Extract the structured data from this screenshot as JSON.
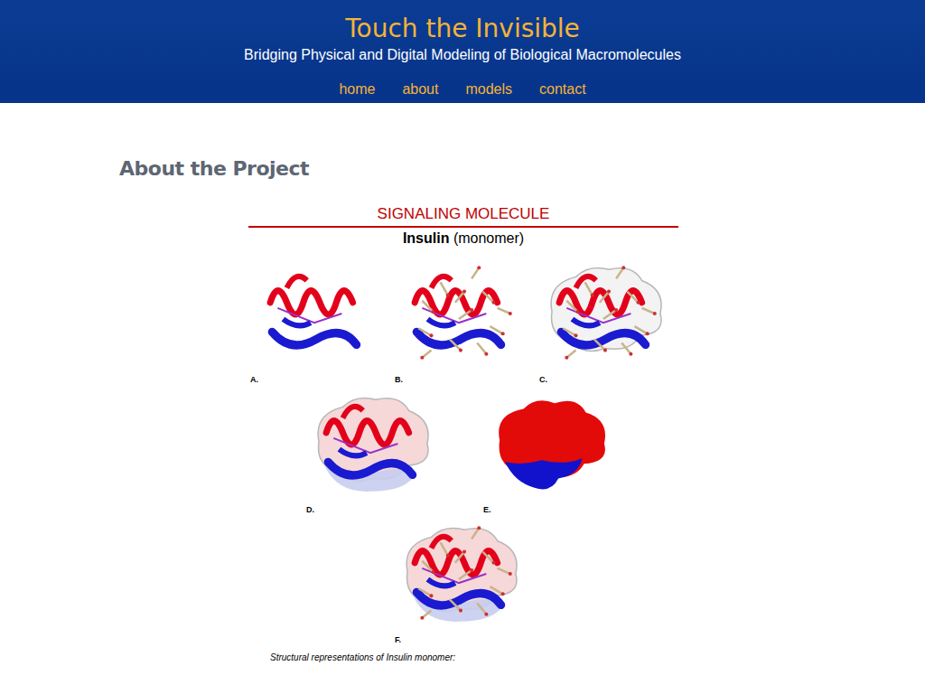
{
  "site": {
    "title": "Touch the Invisible",
    "subtitle": "Bridging Physical and Digital Modeling of Biological Macromolecules"
  },
  "nav": [
    {
      "label": "home"
    },
    {
      "label": "about"
    },
    {
      "label": "models"
    },
    {
      "label": "contact"
    }
  ],
  "page": {
    "heading": "About the Project"
  },
  "figure": {
    "category": "SIGNALING MOLECULE",
    "molecule": "Insulin",
    "qualifier": "(monomer)",
    "rows": [
      [
        {
          "label": "A.",
          "kind": "ribbon"
        },
        {
          "label": "B.",
          "kind": "sticks"
        },
        {
          "label": "C.",
          "kind": "clear-surface"
        }
      ],
      [
        {
          "label": "D.",
          "kind": "tinted-surface"
        },
        {
          "label": "E.",
          "kind": "solid-surface"
        }
      ],
      [
        {
          "label": "F.",
          "kind": "mixed"
        }
      ]
    ],
    "caption": "Structural representations of Insulin monomer:"
  }
}
